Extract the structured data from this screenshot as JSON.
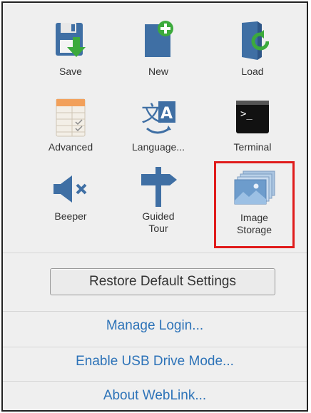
{
  "tiles": {
    "save": "Save",
    "new": "New",
    "load": "Load",
    "advanced": "Advanced",
    "language": "Language...",
    "terminal": "Terminal",
    "beeper": "Beeper",
    "guided_tour_1": "Guided",
    "guided_tour_2": "Tour",
    "image_storage_1": "Image",
    "image_storage_2": "Storage"
  },
  "restore_button": "Restore Default Settings",
  "links": {
    "manage_login": "Manage Login...",
    "usb_drive": "Enable USB Drive Mode...",
    "about": "About WebLink..."
  },
  "colors": {
    "link": "#2d73b8",
    "highlight": "#e01b1b",
    "icon_blue": "#3f6fa4",
    "icon_green": "#3caa3c"
  }
}
